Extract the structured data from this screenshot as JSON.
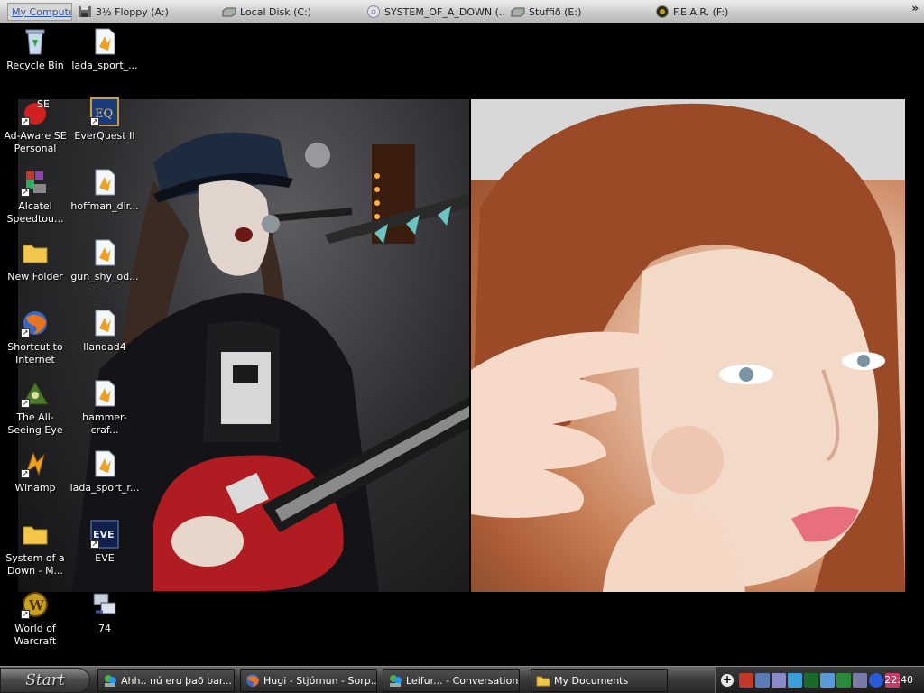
{
  "drivebar": {
    "items": [
      {
        "label": "My Computer",
        "icon": "computer-icon"
      },
      {
        "label": "3½ Floppy (A:)",
        "icon": "floppy-icon"
      },
      {
        "label": "Local Disk (C:)",
        "icon": "hard-disk-icon"
      },
      {
        "label": "SYSTEM_OF_A_DOWN (...",
        "icon": "cd-icon"
      },
      {
        "label": "Stuffið (E:)",
        "icon": "hard-disk-icon"
      },
      {
        "label": "F.E.A.R. (F:)",
        "icon": "fear-disc-icon"
      }
    ],
    "more": "»"
  },
  "desktop": {
    "icons": [
      {
        "label": "Recycle Bin",
        "icon": "recycle-bin-icon"
      },
      {
        "label": "lada_sport_...",
        "icon": "media-file-icon"
      },
      {
        "label": "Ad-Aware SE Personal",
        "icon": "ad-aware-icon"
      },
      {
        "label": "EverQuest II",
        "icon": "everquest-icon"
      },
      {
        "label": "Alcatel Speedtou...",
        "icon": "alcatel-icon"
      },
      {
        "label": "hoffman_dir...",
        "icon": "media-file-icon"
      },
      {
        "label": "New Folder",
        "icon": "folder-icon"
      },
      {
        "label": "gun_shy_od...",
        "icon": "media-file-icon"
      },
      {
        "label": "Shortcut to Internet",
        "icon": "firefox-icon"
      },
      {
        "label": "llandad4",
        "icon": "media-file-icon"
      },
      {
        "label": "The All-Seeing Eye",
        "icon": "all-seeing-eye-icon"
      },
      {
        "label": "hammer-craf...",
        "icon": "media-file-icon"
      },
      {
        "label": "Winamp",
        "icon": "winamp-icon"
      },
      {
        "label": "lada_sport_r...",
        "icon": "media-file-icon"
      },
      {
        "label": "System of a Down - M...",
        "icon": "folder-icon"
      },
      {
        "label": "EVE",
        "icon": "eve-icon"
      },
      {
        "label": "World of Warcraft",
        "icon": "warcraft-icon"
      },
      {
        "label": "74",
        "icon": "network-app-icon"
      }
    ]
  },
  "taskbar": {
    "start_label": "Start",
    "tasks": [
      {
        "label": "Ahh.. nú eru það bar...",
        "icon": "msn-icon"
      },
      {
        "label": "Hugi - Stjórnun - Sorp...",
        "icon": "firefox-icon"
      },
      {
        "label": "Leifur... - Conversation",
        "icon": "msn-icon"
      },
      {
        "label": "My Documents",
        "icon": "folder-icon"
      }
    ],
    "tray": {
      "expand_label": "+",
      "icons": [
        "ati-icon",
        "network-icon",
        "volume-icon",
        "msn-tray-icon",
        "monitor-icon",
        "speedtouch-icon",
        "security-icon",
        "tool-icon",
        "info-icon",
        "app-icon"
      ],
      "clock": "22:40"
    }
  },
  "colors": {
    "taskbar_dark": "#262626",
    "drivebar_light": "#ececec",
    "desktop_bg": "#000000"
  }
}
